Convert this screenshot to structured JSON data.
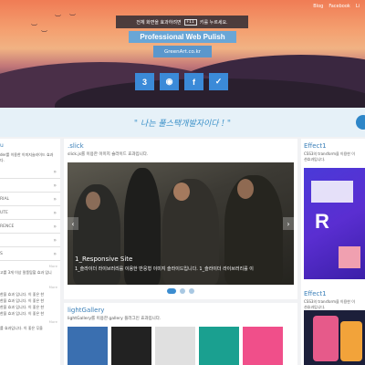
{
  "header": {
    "nav": [
      "Blog",
      "Facebook",
      "Li"
    ],
    "notice_prefix": "전체 화면을 효과하려면",
    "notice_key": "F11",
    "notice_suffix": "키를 누르세요.",
    "title": "Professional Web Pulish",
    "site": "GreenArt.co.kr",
    "socials": [
      {
        "icon": "css3-icon",
        "glyph": "3"
      },
      {
        "icon": "github-icon",
        "glyph": "◉"
      },
      {
        "icon": "facebook-icon",
        "glyph": "f"
      },
      {
        "icon": "twitter-icon",
        "glyph": "✓"
      }
    ]
  },
  "slogan": "\" 나는 풀스택개발자이다 ! \"",
  "left": {
    "heading": "u",
    "desc": [
      "der를 이용한 이미지슬라이드 효과",
      "다."
    ],
    "items": [
      "",
      "",
      "RIAL",
      "UTE",
      "RENCE",
      "",
      "S"
    ],
    "more": "More",
    "intro": "고를 3개 이상 말풍탐할 효과 입니",
    "more2": "More",
    "list": [
      "한을 효과 입니다. 이 좋은 한",
      "한을 효과 입니다. 이 좋은 한",
      "한을 효과 입니다. 이 좋은 한",
      "한을 효과 입니다. 이 좋은 한"
    ],
    "more3": "More",
    "foot": "를 효과입니다. 이 좋은 무을"
  },
  "slick": {
    "title": ".slick",
    "desc": "slick.js를 이용한 이미지 슬라이드 효과입니다.",
    "caption_title": "1_Responsive Site",
    "caption_desc": "1_슬라이더 라이브러리를 이용한 반응형 이미지 슬라이드입니다. 1_슬라이더 라이브러리를 이",
    "prev": "‹",
    "next": "›"
  },
  "gallery": {
    "title": "lightGallery",
    "desc": "lightGallery를 이용한 gallery 플러그인 효과입니다.",
    "thumbs": [
      "#3a6fb0",
      "#222222",
      "#e0e0e0",
      "#1aa090",
      "#f04f8a",
      "#f2a33a"
    ]
  },
  "right": {
    "effect1_title": "Effect1",
    "effect1_desc": [
      "CSS3의 transform을 이용한 이",
      "션효과입니다."
    ],
    "effect2_title": "Effect1",
    "effect2_desc": [
      "CSS3의 transform을 이용한 이",
      "션효과입니다."
    ],
    "colors": {
      "purple": "#5a2ed1",
      "pink": "#f0a0b0",
      "dark": "#1c1f3a"
    }
  }
}
